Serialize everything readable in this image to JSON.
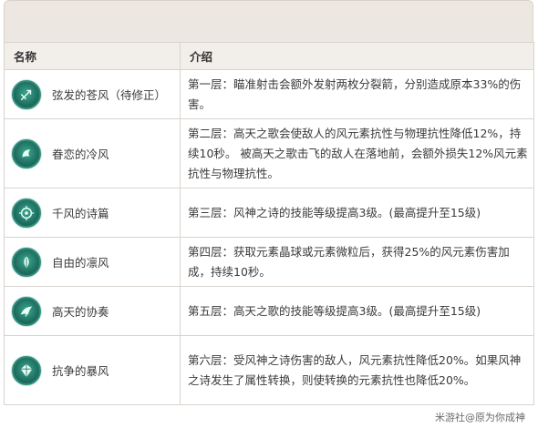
{
  "table": {
    "headers": {
      "name": "名称",
      "desc": "介绍"
    },
    "rows": [
      {
        "name": "弦发的苍风（待修正）",
        "icon": "arrows-icon",
        "desc": "第一层：瞄准射击会额外发射两枚分裂箭，分别造成原本33%的伤害。"
      },
      {
        "name": "眷恋的冷风",
        "icon": "wind-crest-icon",
        "desc": "第二层：高天之歌会使敌人的风元素抗性与物理抗性降低12%，持续10秒。 被高天之歌击飞的敌人在落地前，会额外损失12%风元素抗性与物理抗性。"
      },
      {
        "name": "千风的诗篇",
        "icon": "target-icon",
        "desc": "第三层：风神之诗的技能等级提高3级。(最高提升至15级)"
      },
      {
        "name": "自由的凛风",
        "icon": "leaf-icon",
        "desc": "第四层：获取元素晶球或元素微粒后，获得25%的风元素伤害加成，持续10秒。"
      },
      {
        "name": "高天的协奏",
        "icon": "wing-icon",
        "desc": "第五层：高天之歌的技能等级提高3级。(最高提升至15级)"
      },
      {
        "name": "抗争的暴风",
        "icon": "gem-icon",
        "desc": "第六层：受风神之诗伤害的敌人，风元素抗性降低20%。如果风神之诗发生了属性转换，则使转换的元素抗性也降低20%。"
      }
    ]
  },
  "watermark": "米游社@原为你成神",
  "colors": {
    "header_bg": "#f2eeea",
    "band_bg": "#ede7e1",
    "border": "#d9d3cd",
    "icon": "#1f6f61"
  }
}
